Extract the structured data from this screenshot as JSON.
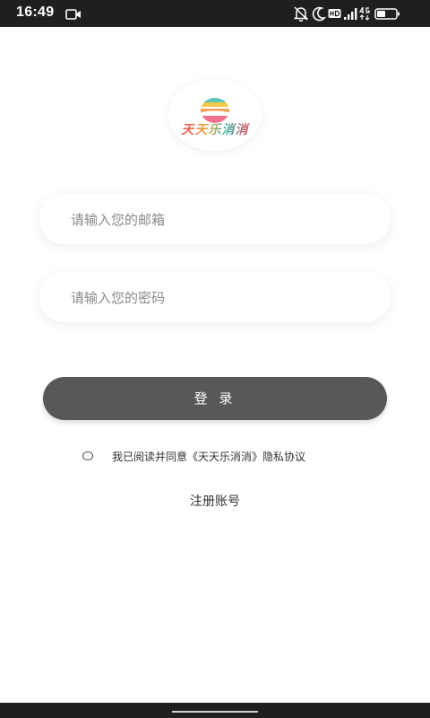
{
  "status_bar": {
    "time": "16:49",
    "icons": [
      "video-camera-icon",
      "bell-off-icon",
      "moon-icon",
      "hd-icon",
      "signal-icon",
      "4g-icon",
      "battery-icon"
    ]
  },
  "logo": {
    "text": "天天乐消消"
  },
  "login_form": {
    "email_placeholder": "请输入您的邮箱",
    "email_value": "",
    "password_placeholder": "请输入您的密码",
    "password_value": "",
    "login_label": "登 录"
  },
  "agreement": {
    "checked": false,
    "text": "我已阅读并同意《天天乐消消》隐私协议"
  },
  "register": {
    "label": "注册账号"
  },
  "colors": {
    "button": "#585858",
    "status_bar": "#1f1f1f",
    "background": "#ffffff"
  }
}
